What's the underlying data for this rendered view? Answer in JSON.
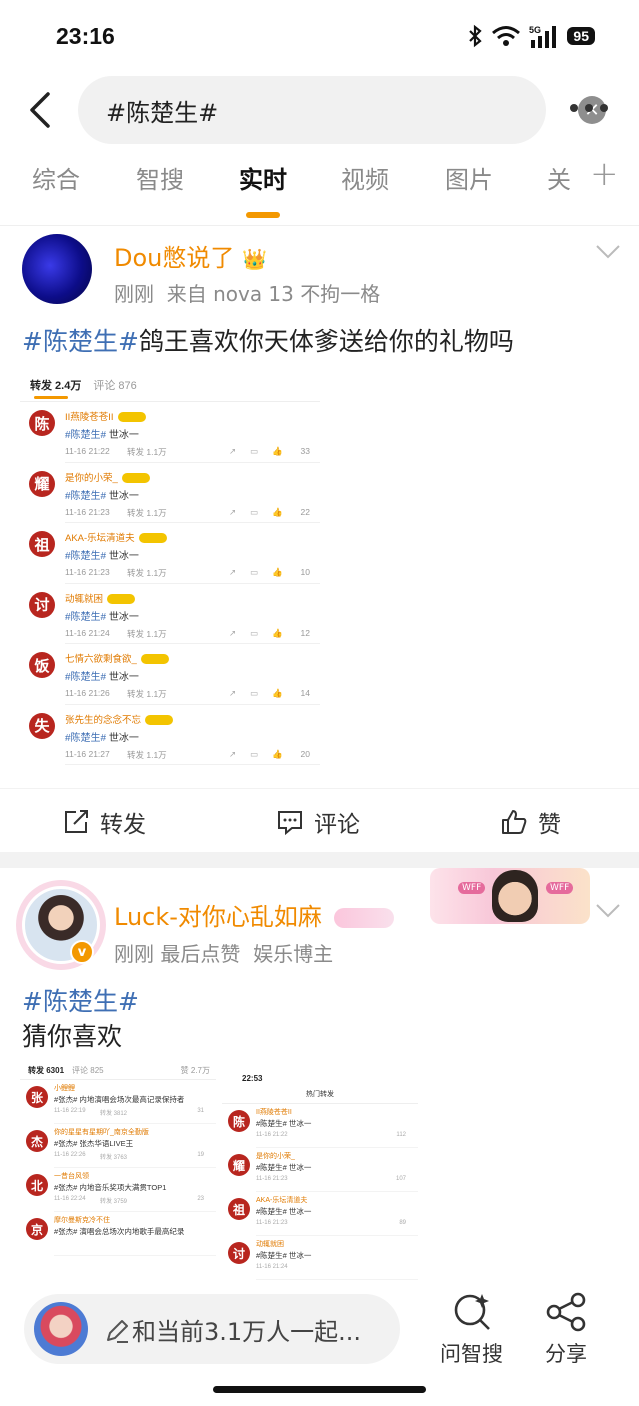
{
  "status": {
    "time": "23:16",
    "battery": "95",
    "network": "5G"
  },
  "search": {
    "query": "#陈楚生#"
  },
  "tabs": [
    "综合",
    "智搜",
    "实时",
    "视频",
    "图片",
    "关"
  ],
  "post1": {
    "author": "Dou憋说了",
    "time": "刚刚",
    "source": "来自 nova 13 不拘一格",
    "hashtag": "#陈楚生#",
    "text": "鸽王喜欢你天体爹送给你的礼物吗",
    "screenshot": {
      "header": {
        "reposts": "转发 2.4万",
        "comments": "评论 876"
      },
      "rows": [
        {
          "avatar": "陈",
          "name": "II燕陵苍苍II",
          "hashtag": "#陈楚生#",
          "text": " 世冰一",
          "time": "11-16 21:22",
          "fw": "转发 1.1万",
          "likes": "33"
        },
        {
          "avatar": "耀",
          "name": "是你的小荣_",
          "hashtag": "#陈楚生#",
          "text": " 世冰一",
          "time": "11-16 21:23",
          "fw": "转发 1.1万",
          "likes": "22"
        },
        {
          "avatar": "祖",
          "name": "AKA-乐坛清道夫",
          "hashtag": "#陈楚生#",
          "text": " 世冰一",
          "time": "11-16 21:23",
          "fw": "转发 1.1万",
          "likes": "10"
        },
        {
          "avatar": "讨",
          "name": "动辄就困",
          "hashtag": "#陈楚生#",
          "text": " 世冰一",
          "time": "11-16 21:24",
          "fw": "转发 1.1万",
          "likes": "12"
        },
        {
          "avatar": "饭",
          "name": "七情六欲剩食欲_",
          "hashtag": "#陈楚生#",
          "text": " 世冰一",
          "time": "11-16 21:26",
          "fw": "转发 1.1万",
          "likes": "14"
        },
        {
          "avatar": "失",
          "name": "张先生的念念不忘",
          "hashtag": "#陈楚生#",
          "text": " 世冰一",
          "time": "11-16 21:27",
          "fw": "转发 1.1万",
          "likes": "20"
        }
      ]
    },
    "actions": {
      "repost": "转发",
      "comment": "评论",
      "like": "赞"
    }
  },
  "post2": {
    "author": "Luck-对你心乱如麻",
    "time": "刚刚",
    "meta": "最后点赞",
    "role": "娱乐博主",
    "hashtag": "#陈楚生#",
    "text": "猜你喜欢",
    "deco": "WFF",
    "shotA": {
      "header": {
        "reposts": "转发 6301",
        "comments": "评论 825",
        "likes": "赞 2.7万"
      },
      "rows": [
        {
          "avatar": "张",
          "name": "小鲤鲤",
          "text": "#张杰# 内地演唱会场次最高记录保持者",
          "time": "11-16 22:19",
          "fw": "转发 3812",
          "likes": "31"
        },
        {
          "avatar": "杰",
          "name": "你的星星有星期吖_南京全勤版",
          "text": "#张杰#  张杰华语LIVE王",
          "time": "11-16 22:26",
          "fw": "转发 3763",
          "likes": "19"
        },
        {
          "avatar": "北",
          "name": "一昔台风领",
          "text": "#张杰# 内地音乐奖项大满贯TOP1",
          "time": "11-16 22:24",
          "fw": "转发 3759",
          "likes": "23"
        },
        {
          "avatar": "京",
          "name": "摩尔曼斯克冷不住",
          "text": "#张杰# 演唱会总场次内地歌手最高纪录",
          "time": "",
          "fw": "",
          "likes": ""
        }
      ]
    },
    "shotB": {
      "time": "22:53",
      "title": "热门转发",
      "rows": [
        {
          "avatar": "陈",
          "name": "II燕陵苍苍II",
          "text": "#陈楚生# 世冰一",
          "time": "11-16 21:22",
          "likes": "112"
        },
        {
          "avatar": "耀",
          "name": "是你的小荣_",
          "text": "#陈楚生# 世冰一",
          "time": "11-16 21:23",
          "likes": "107"
        },
        {
          "avatar": "祖",
          "name": "AKA-乐坛清道夫",
          "text": "#陈楚生# 世冰一",
          "time": "11-16 21:23",
          "likes": "89"
        },
        {
          "avatar": "讨",
          "name": "动辄就困",
          "text": "#陈楚生# 世冰一",
          "time": "11-16 21:24",
          "likes": ""
        }
      ]
    }
  },
  "bottom": {
    "input_placeholder": "和当前3.1万人一起...",
    "ask": "问智搜",
    "share": "分享"
  },
  "colors": {
    "accent": "#f39800",
    "author": "#f08a00",
    "hashtag": "#3f6fb4"
  }
}
